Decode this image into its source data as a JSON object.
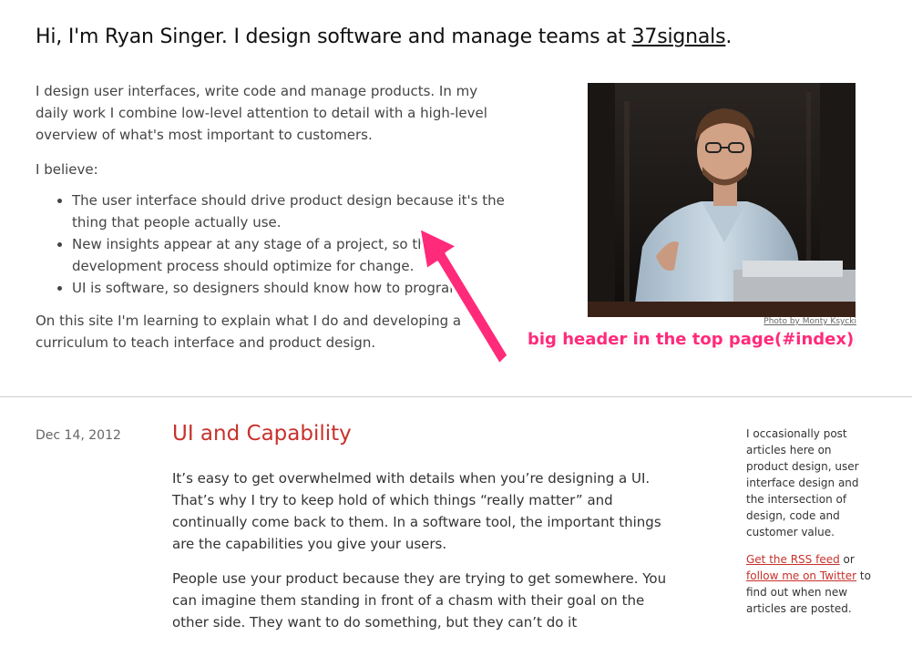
{
  "header": {
    "title_prefix": "Hi, I'm Ryan Singer. I design software and manage teams at ",
    "company_link": "37signals",
    "title_suffix": "."
  },
  "intro": {
    "paragraph": "I design user interfaces, write code and manage products. In my daily work I combine low-level attention to detail with a high-level overview of what's most important to customers.",
    "believe_label": "I believe:",
    "beliefs": [
      "The user interface should drive product design because it's the thing that people actually use.",
      "New insights appear at any stage of a project, so the development process should optimize for change.",
      "UI is software, so designers should know how to program."
    ],
    "closing": "On this site I'm learning to explain what I do and developing a curriculum to teach interface and product design."
  },
  "photo": {
    "caption": "Photo by Monty Ksycki"
  },
  "annotation": {
    "text": "big header in the top page(#index)",
    "color": "#ff2a7a"
  },
  "post": {
    "date": "Dec 14, 2012",
    "title": "UI and Capability",
    "paragraphs": [
      "It’s easy to get overwhelmed with details when you’re designing a UI. That’s why I try to keep hold of which things “really matter” and continually come back to them. In a software tool, the important things are the capabilities you give your users.",
      "People use your product because they are trying to get somewhere. You can imagine them standing in front of a chasm with their goal on the other side. They want to do something, but they can’t do it"
    ]
  },
  "sidebar": {
    "about": "I occasionally post articles here on product design, user interface design and the intersection of design, code and customer value.",
    "rss_link": "Get the RSS feed",
    "or_text": " or ",
    "twitter_link": "follow me on Twitter",
    "suffix": " to find out when new articles are posted."
  },
  "colors": {
    "accent": "#c8312b",
    "annotation": "#ff2a7a"
  }
}
